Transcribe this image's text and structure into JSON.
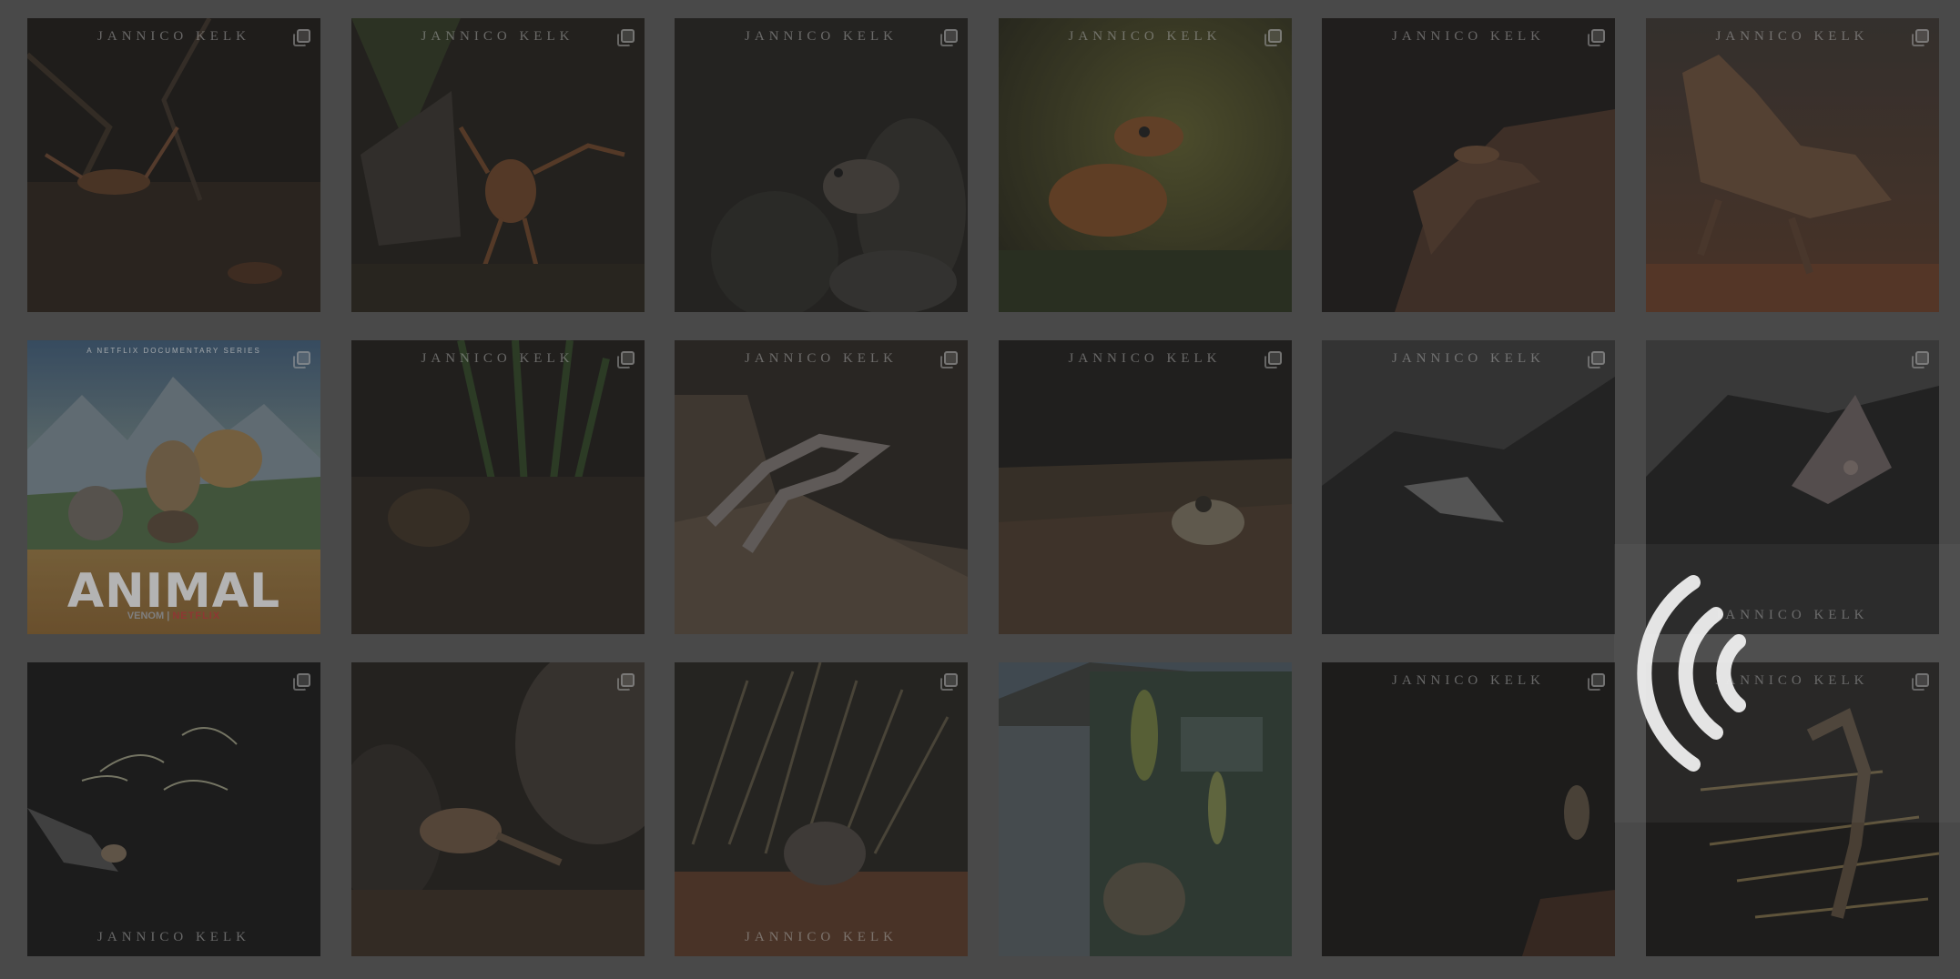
{
  "watermark": "JANNICO KELK",
  "icons": {
    "multi_image": "carousel-icon",
    "cast": "cast-icon"
  },
  "poster": {
    "top_line": "A NETFLIX DOCUMENTARY SERIES",
    "title": "ANIMAL",
    "foot_left": "VENOM",
    "foot_right": "NETFLIX"
  },
  "grid": {
    "rows": 3,
    "columns": 6,
    "tiles": [
      {
        "subject": "crayfish",
        "watermark": "top",
        "multi": true
      },
      {
        "subject": "crayfish-claws",
        "watermark": "top",
        "multi": true
      },
      {
        "subject": "possum-on-rock",
        "watermark": "top",
        "multi": true
      },
      {
        "subject": "frog",
        "watermark": "top",
        "multi": true
      },
      {
        "subject": "lizard-on-rock",
        "watermark": "top",
        "multi": true
      },
      {
        "subject": "thorny-devil",
        "watermark": "top",
        "multi": true
      },
      {
        "subject": "animal-poster",
        "watermark": "none",
        "multi": true
      },
      {
        "subject": "bandicoot-in-grass",
        "watermark": "top",
        "multi": true
      },
      {
        "subject": "gecko-on-rock",
        "watermark": "top",
        "multi": true
      },
      {
        "subject": "gecko-on-sand",
        "watermark": "top",
        "multi": true
      },
      {
        "subject": "bat-over-rock",
        "watermark": "top",
        "multi": true
      },
      {
        "subject": "bat-in-cave",
        "watermark": "bottom",
        "multi": true
      },
      {
        "subject": "bat-with-insects",
        "watermark": "bottom",
        "multi": true
      },
      {
        "subject": "quoll-on-rocks",
        "watermark": "none",
        "multi": true
      },
      {
        "subject": "quoll-in-spinifex",
        "watermark": "bottom",
        "multi": true
      },
      {
        "subject": "quoll-mural-building",
        "watermark": "none",
        "multi": false
      },
      {
        "subject": "mammal-at-night",
        "watermark": "top",
        "multi": true
      },
      {
        "subject": "dragon-on-spinifex",
        "watermark": "top",
        "multi": true
      }
    ]
  }
}
